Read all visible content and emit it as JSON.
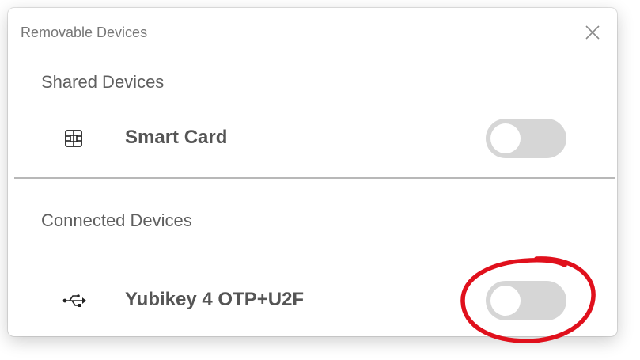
{
  "dialog": {
    "title": "Removable Devices",
    "close_icon": "close-icon"
  },
  "sections": {
    "shared": {
      "title": "Shared Devices",
      "device": {
        "name": "Smart Card",
        "icon": "smart-card-icon",
        "enabled": false
      }
    },
    "connected": {
      "title": "Connected Devices",
      "device": {
        "name": "Yubikey 4 OTP+U2F",
        "icon": "usb-icon",
        "enabled": false
      }
    }
  },
  "colors": {
    "toggle_off": "#d6d6d6",
    "annotation": "#e0101c"
  }
}
